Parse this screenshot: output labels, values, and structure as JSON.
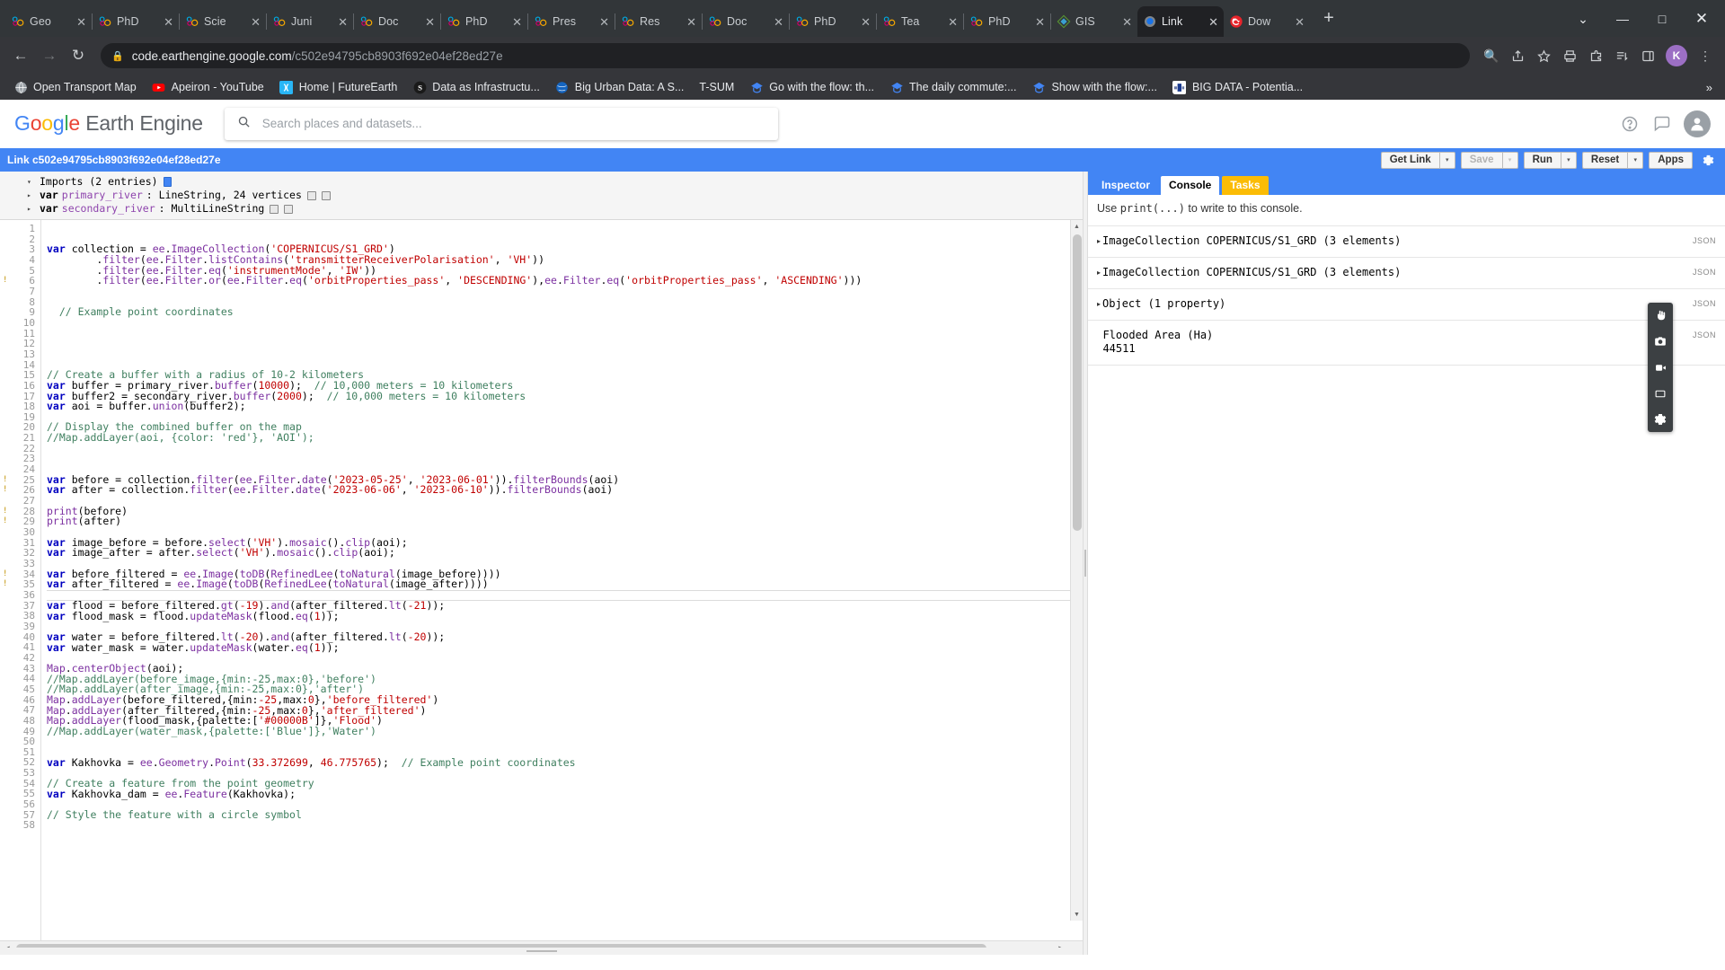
{
  "browser": {
    "tabs": [
      {
        "title": "Geo",
        "favicon": "mendeley-icon",
        "active": false
      },
      {
        "title": "PhD",
        "favicon": "mendeley-icon",
        "active": false
      },
      {
        "title": "Scie",
        "favicon": "mendeley-icon",
        "active": false
      },
      {
        "title": "Juni",
        "favicon": "mendeley-icon",
        "active": false
      },
      {
        "title": "Doc",
        "favicon": "mendeley-icon",
        "active": false
      },
      {
        "title": "PhD",
        "favicon": "mendeley-icon",
        "active": false
      },
      {
        "title": "Pres",
        "favicon": "mendeley-icon",
        "active": false
      },
      {
        "title": "Res",
        "favicon": "mendeley-icon",
        "active": false
      },
      {
        "title": "Doc",
        "favicon": "mendeley-icon",
        "active": false
      },
      {
        "title": "PhD",
        "favicon": "mendeley-icon",
        "active": false
      },
      {
        "title": "Tea",
        "favicon": "mendeley-icon",
        "active": false
      },
      {
        "title": "PhD",
        "favicon": "mendeley-icon",
        "active": false
      },
      {
        "title": "GIS",
        "favicon": "qgis-icon",
        "active": false
      },
      {
        "title": "Link",
        "favicon": "earthengine-icon",
        "active": true
      },
      {
        "title": "Dow",
        "favicon": "refresh-red-icon",
        "active": false
      }
    ],
    "close_glyph": "✕",
    "new_tab_glyph": "+",
    "tab_list_glyph": "⌄",
    "window": {
      "minimize": "—",
      "maximize": "□",
      "close": "✕"
    },
    "nav": {
      "back": "←",
      "forward": "→",
      "reload": "↻"
    },
    "omnibox": {
      "lock_icon": "lock-icon",
      "url_domain": "code.earthengine.google.com",
      "url_path": "/c502e94795cb8903f692e04ef28ed27e"
    },
    "toolbar_icons": [
      "search-icon",
      "share-icon",
      "bookmark-star-icon",
      "print-icon",
      "extensions-icon",
      "reading-list-icon",
      "side-panel-icon"
    ],
    "profile_initial": "K",
    "menu_glyph": "⋮",
    "bookmarks": [
      {
        "label": "Open Transport Map",
        "icon": "globe-icon",
        "color": "#9aa0a6"
      },
      {
        "label": "Apeiron - YouTube",
        "icon": "youtube-icon",
        "color": "#FF0000"
      },
      {
        "label": "Home | FutureEarth",
        "icon": "futureearth-icon",
        "color": "#29b6f6"
      },
      {
        "label": "Data as Infrastructu...",
        "icon": "scoop-s-icon",
        "color": "#1a1a1a"
      },
      {
        "label": "Big Urban Data: A S...",
        "icon": "globe-blue-icon",
        "color": "#1565c0"
      },
      {
        "label": "T-SUM",
        "icon": "none",
        "color": "#35363a"
      },
      {
        "label": "Go with the flow: th...",
        "icon": "google-scholar-icon",
        "color": "#4285F4"
      },
      {
        "label": "The daily commute:...",
        "icon": "google-scholar-icon",
        "color": "#4285F4"
      },
      {
        "label": "Show with the flow:...",
        "icon": "google-scholar-icon",
        "color": "#4285F4"
      },
      {
        "label": "BIG DATA - Potentia...",
        "icon": "document-icon",
        "color": "#1a3a8f"
      }
    ],
    "bookmarks_overflow": "»"
  },
  "ee": {
    "logo": {
      "google": [
        "G",
        "o",
        "o",
        "g",
        "l",
        "e"
      ],
      "word": "Earth Engine"
    },
    "search": {
      "placeholder": "Search places and datasets...",
      "value": "",
      "icon": "search-icon"
    },
    "header_icons": [
      "help-icon",
      "feedback-icon"
    ],
    "avatar_glyph": "●",
    "toolbar": {
      "link_label": "Link c502e94795cb8903f692e04ef28ed27e",
      "get_link": "Get Link",
      "save": "Save",
      "run": "Run",
      "reset": "Reset",
      "apps": "Apps",
      "gear_icon": "gear-icon",
      "dropdown_glyph": "▾"
    },
    "imports": {
      "header": "Imports (2 entries)",
      "caret": "▾",
      "entries": [
        {
          "kw": "var",
          "name": "primary_river",
          "type": ": LineString, 24 vertices"
        },
        {
          "kw": "var",
          "name": "secondary_river",
          "type": ": MultiLineString"
        }
      ]
    },
    "console": {
      "tabs": [
        {
          "label": "Inspector",
          "state": "inactive"
        },
        {
          "label": "Console",
          "state": "active"
        },
        {
          "label": "Tasks",
          "state": "tasks"
        }
      ],
      "hint_prefix": "Use ",
      "hint_mono": "print(...)",
      "hint_suffix": " to write to this console.",
      "rows": [
        {
          "caret": "▸",
          "text": "ImageCollection COPERNICUS/S1_GRD (3 elements)",
          "json": "JSON"
        },
        {
          "caret": "▸",
          "text": "ImageCollection COPERNICUS/S1_GRD (3 elements)",
          "json": "JSON"
        },
        {
          "caret": "▸",
          "text": "Object (1 property)",
          "json": "JSON"
        },
        {
          "caret": "",
          "text": "Flooded Area (Ha)",
          "text2": "44511",
          "json": "JSON"
        }
      ]
    },
    "map_tools": [
      {
        "icon": "pan-hand-icon"
      },
      {
        "icon": "camera-icon"
      },
      {
        "icon": "video-icon"
      },
      {
        "icon": "rectangle-icon"
      },
      {
        "icon": "settings-gear-icon"
      }
    ],
    "code_lines": [
      {
        "n": 1,
        "text": ""
      },
      {
        "n": 2,
        "text": ""
      },
      {
        "n": 3,
        "text": "var collection = ee.ImageCollection('COPERNICUS/S1_GRD')"
      },
      {
        "n": 4,
        "text": "        .filter(ee.Filter.listContains('transmitterReceiverPolarisation', 'VH'))"
      },
      {
        "n": 5,
        "text": "        .filter(ee.Filter.eq('instrumentMode', 'IW'))"
      },
      {
        "n": 6,
        "text": "        .filter(ee.Filter.or(ee.Filter.eq('orbitProperties_pass', 'DESCENDING'),ee.Filter.eq('orbitProperties_pass', 'ASCENDING')))",
        "warn": true
      },
      {
        "n": 7,
        "text": ""
      },
      {
        "n": 8,
        "text": ""
      },
      {
        "n": 9,
        "text": "  // Example point coordinates"
      },
      {
        "n": 10,
        "text": ""
      },
      {
        "n": 11,
        "text": ""
      },
      {
        "n": 12,
        "text": ""
      },
      {
        "n": 13,
        "text": ""
      },
      {
        "n": 14,
        "text": ""
      },
      {
        "n": 15,
        "text": "// Create a buffer with a radius of 10-2 kilometers"
      },
      {
        "n": 16,
        "text": "var buffer = primary_river.buffer(10000);  // 10,000 meters = 10 kilometers"
      },
      {
        "n": 17,
        "text": "var buffer2 = secondary_river.buffer(2000);  // 10,000 meters = 10 kilometers"
      },
      {
        "n": 18,
        "text": "var aoi = buffer.union(buffer2);"
      },
      {
        "n": 19,
        "text": ""
      },
      {
        "n": 20,
        "text": "// Display the combined buffer on the map"
      },
      {
        "n": 21,
        "text": "//Map.addLayer(aoi, {color: 'red'}, 'AOI');"
      },
      {
        "n": 22,
        "text": ""
      },
      {
        "n": 23,
        "text": ""
      },
      {
        "n": 24,
        "text": ""
      },
      {
        "n": 25,
        "text": "var before = collection.filter(ee.Filter.date('2023-05-25', '2023-06-01')).filterBounds(aoi)",
        "warn": true
      },
      {
        "n": 26,
        "text": "var after = collection.filter(ee.Filter.date('2023-06-06', '2023-06-10')).filterBounds(aoi)",
        "warn": true
      },
      {
        "n": 27,
        "text": ""
      },
      {
        "n": 28,
        "text": "print(before)",
        "warn": true
      },
      {
        "n": 29,
        "text": "print(after)",
        "warn": true
      },
      {
        "n": 30,
        "text": ""
      },
      {
        "n": 31,
        "text": "var image_before = before.select('VH').mosaic().clip(aoi);"
      },
      {
        "n": 32,
        "text": "var image_after = after.select('VH').mosaic().clip(aoi);"
      },
      {
        "n": 33,
        "text": ""
      },
      {
        "n": 34,
        "text": "var before_filtered = ee.Image(toDB(RefinedLee(toNatural(image_before))))",
        "warn": true
      },
      {
        "n": 35,
        "text": "var after_filtered = ee.Image(toDB(RefinedLee(toNatural(image_after))))",
        "warn": true
      },
      {
        "n": 36,
        "text": "",
        "cursor": true
      },
      {
        "n": 37,
        "text": "var flood = before_filtered.gt(-19).and(after_filtered.lt(-21));"
      },
      {
        "n": 38,
        "text": "var flood_mask = flood.updateMask(flood.eq(1));"
      },
      {
        "n": 39,
        "text": ""
      },
      {
        "n": 40,
        "text": "var water = before_filtered.lt(-20).and(after_filtered.lt(-20));"
      },
      {
        "n": 41,
        "text": "var water_mask = water.updateMask(water.eq(1));"
      },
      {
        "n": 42,
        "text": ""
      },
      {
        "n": 43,
        "text": "Map.centerObject(aoi);"
      },
      {
        "n": 44,
        "text": "//Map.addLayer(before_image,{min:-25,max:0},'before')"
      },
      {
        "n": 45,
        "text": "//Map.addLayer(after_image,{min:-25,max:0},'after')"
      },
      {
        "n": 46,
        "text": "Map.addLayer(before_filtered,{min:-25,max:0},'before_filtered')"
      },
      {
        "n": 47,
        "text": "Map.addLayer(after_filtered,{min:-25,max:0},'after_filtered')"
      },
      {
        "n": 48,
        "text": "Map.addLayer(flood_mask,{palette:['#00000B']},'Flood')"
      },
      {
        "n": 49,
        "text": "//Map.addLayer(water_mask,{palette:['Blue']},'Water')"
      },
      {
        "n": 50,
        "text": ""
      },
      {
        "n": 51,
        "text": ""
      },
      {
        "n": 52,
        "text": "var Kakhovka = ee.Geometry.Point(33.372699, 46.775765);  // Example point coordinates"
      },
      {
        "n": 53,
        "text": ""
      },
      {
        "n": 54,
        "text": "// Create a feature from the point geometry"
      },
      {
        "n": 55,
        "text": "var Kakhovka_dam = ee.Feature(Kakhovka);"
      },
      {
        "n": 56,
        "text": ""
      },
      {
        "n": 57,
        "text": "// Style the feature with a circle symbol"
      },
      {
        "n": 58,
        "text": ""
      }
    ]
  }
}
